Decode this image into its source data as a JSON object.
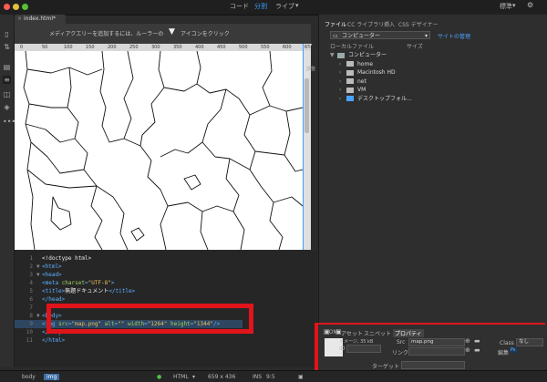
{
  "titlebar": {
    "modes": [
      "コード",
      "分割",
      "ライブ"
    ],
    "active_mode": "分割",
    "workspace": "標準",
    "workspace_caret": "▾",
    "live_caret": "▾"
  },
  "document": {
    "tab_name": "index.html*"
  },
  "design_view": {
    "hint": "メディアクエリーを追加するには、ルーラーの",
    "hint_suffix": "アイコンをクリック",
    "ruler_marks": [
      "0",
      "50",
      "100",
      "150",
      "200",
      "250",
      "300",
      "350",
      "400",
      "450",
      "500",
      "550",
      "600",
      "650"
    ]
  },
  "code": {
    "lines": [
      {
        "n": "1",
        "arrow": "",
        "parts": [
          [
            "txt",
            "<!doctype html>"
          ]
        ]
      },
      {
        "n": "2",
        "arrow": "▼",
        "parts": [
          [
            "tag",
            "<html>"
          ]
        ]
      },
      {
        "n": "3",
        "arrow": "▼",
        "parts": [
          [
            "tag",
            "<head>"
          ]
        ]
      },
      {
        "n": "4",
        "arrow": "",
        "parts": [
          [
            "tag",
            "<meta "
          ],
          [
            "attr",
            "charset"
          ],
          [
            "tag",
            "="
          ],
          [
            "val",
            "\"UTF-8\""
          ],
          [
            "tag",
            ">"
          ]
        ]
      },
      {
        "n": "5",
        "arrow": "",
        "parts": [
          [
            "tag",
            "<title>"
          ],
          [
            "txt",
            "無題ドキュメント"
          ],
          [
            "tag",
            "</title>"
          ]
        ]
      },
      {
        "n": "6",
        "arrow": "",
        "parts": [
          [
            "tag",
            "</head>"
          ]
        ]
      },
      {
        "n": "7",
        "arrow": "",
        "parts": []
      },
      {
        "n": "8",
        "arrow": "▼",
        "parts": [
          [
            "tag",
            "<body>"
          ]
        ]
      },
      {
        "n": "9",
        "arrow": "",
        "parts": [
          [
            "tag",
            "<img "
          ],
          [
            "attr",
            "src"
          ],
          [
            "tag",
            "="
          ],
          [
            "val",
            "\"map.png\""
          ],
          [
            "tag",
            " "
          ],
          [
            "attr",
            "alt"
          ],
          [
            "tag",
            "="
          ],
          [
            "val",
            "\"\""
          ],
          [
            "tag",
            " "
          ],
          [
            "attr",
            "width"
          ],
          [
            "tag",
            "="
          ],
          [
            "val",
            "\"1264\""
          ],
          [
            "tag",
            " "
          ],
          [
            "attr",
            "height"
          ],
          [
            "tag",
            "="
          ],
          [
            "val",
            "\"1344\""
          ],
          [
            "tag",
            "/>"
          ]
        ]
      },
      {
        "n": "10",
        "arrow": "",
        "parts": [
          [
            "tag",
            "</body>"
          ]
        ]
      },
      {
        "n": "11",
        "arrow": "",
        "parts": [
          [
            "tag",
            "</html>"
          ]
        ]
      }
    ]
  },
  "files_panel": {
    "tabs": [
      "ファイル",
      "CC ライブラリ",
      "挿入",
      "CSS デザイナー"
    ],
    "active_tab": "ファイル",
    "site_select": "コンピューター",
    "site_link": "サイトの管理",
    "col_local": "ローカルファイル",
    "col_size": "サイズ",
    "tree": [
      {
        "label": "コンピューター",
        "level": 0,
        "chev": "▼",
        "icon": "computer-icon"
      },
      {
        "label": "home",
        "level": 1,
        "chev": "›",
        "icon": "drive-icon"
      },
      {
        "label": "Macintosh HD",
        "level": 1,
        "chev": "›",
        "icon": "drive-icon"
      },
      {
        "label": "net",
        "level": 1,
        "chev": "›",
        "icon": "drive-icon"
      },
      {
        "label": "VM",
        "level": 1,
        "chev": "›",
        "icon": "drive-icon"
      },
      {
        "label": "デスクトップフォル...",
        "level": 1,
        "chev": "›",
        "icon": "folder-icon"
      }
    ]
  },
  "properties": {
    "tabs": [
      "DOM",
      "アセット",
      "スニペット",
      "プロパティ"
    ],
    "active_tab": "プロパティ",
    "image_label": "イメージ, 35 kB",
    "id_label": "ID",
    "src_label": "Src",
    "src_value": "map.png",
    "link_label": "リンク",
    "class_label": "Class",
    "class_value": "なし",
    "edit_label": "編集",
    "target_label": "ターゲット",
    "ps_label": "Ps"
  },
  "status": {
    "tags": [
      "body",
      "img"
    ],
    "active_tag": "img",
    "language": "HTML",
    "size": "659 x 436",
    "ins": "INS",
    "pos": "9:5",
    "lang_caret": "▾"
  },
  "colors": {
    "accent": "#3aa0ff",
    "highlight": "#e0141a"
  }
}
